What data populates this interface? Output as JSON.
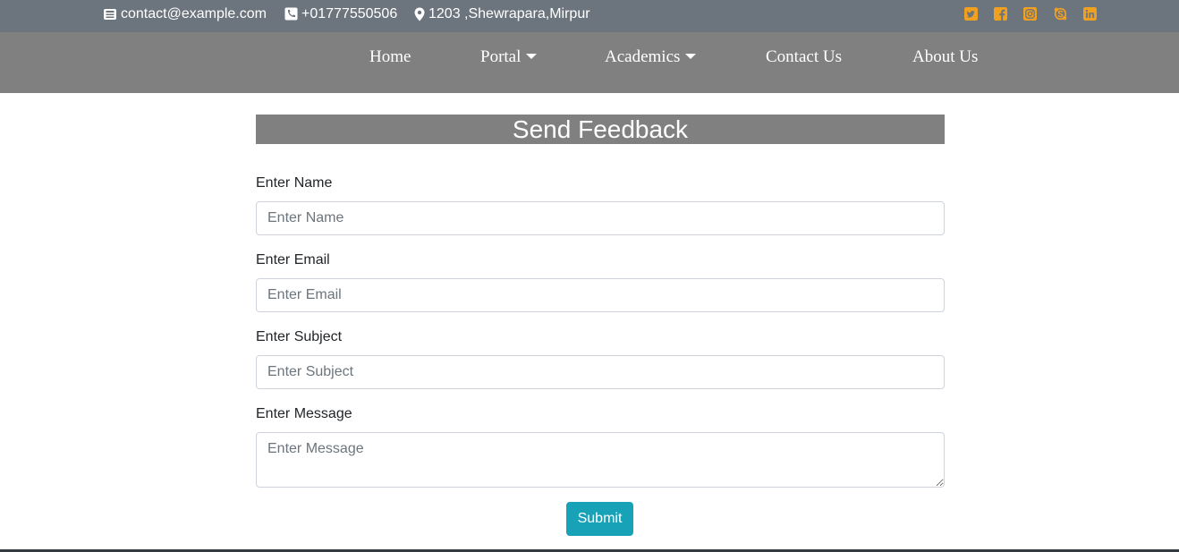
{
  "topbar": {
    "email": "contact@example.com",
    "phone": "+01777550506",
    "address": "1203 ,Shewrapara,Mirpur",
    "social_icons": [
      "twitter-icon",
      "facebook-icon",
      "instagram-icon",
      "skype-icon",
      "linkedin-icon"
    ],
    "social_color": "#f0a020"
  },
  "nav": {
    "items": [
      {
        "label": "Home"
      },
      {
        "label": "Portal"
      },
      {
        "label": "Academics"
      },
      {
        "label": "Contact Us"
      },
      {
        "label": "About Us"
      }
    ]
  },
  "form": {
    "title": "Send Feedback",
    "fields": [
      {
        "label": "Enter Name",
        "placeholder": "Enter Name",
        "value": ""
      },
      {
        "label": "Enter Email",
        "placeholder": "Enter Email",
        "value": ""
      },
      {
        "label": "Enter Subject",
        "placeholder": "Enter Subject",
        "value": ""
      },
      {
        "label": "Enter Message",
        "placeholder": "Enter Message",
        "value": ""
      }
    ],
    "submit_label": "Submit"
  },
  "colors": {
    "topbar_bg": "#6c757d",
    "navbar_bg": "#808080",
    "accent": "#17a2b8"
  }
}
